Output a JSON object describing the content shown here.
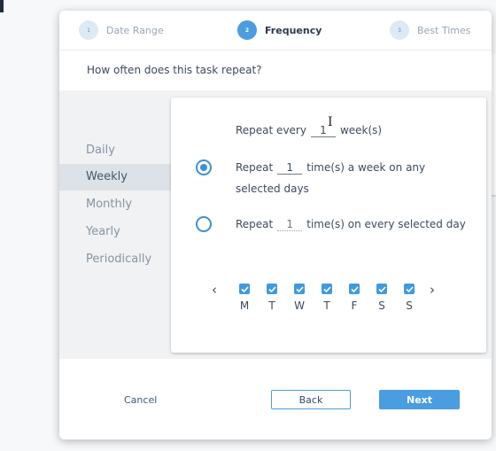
{
  "steps": [
    {
      "num": "1",
      "label": "Date Range",
      "active": false
    },
    {
      "num": "2",
      "label": "Frequency",
      "active": true
    },
    {
      "num": "3",
      "label": "Best Times",
      "active": false
    }
  ],
  "question": "How often does this task repeat?",
  "frequency_options": [
    "Daily",
    "Weekly",
    "Monthly",
    "Yearly",
    "Periodically"
  ],
  "selected_frequency": "Weekly",
  "repeat_every": {
    "prefix": "Repeat every",
    "value": "1",
    "suffix": "week(s)"
  },
  "option_a": {
    "prefix": "Repeat",
    "value": "1",
    "suffix_line1": "time(s) a week on any",
    "suffix_line2": "selected days",
    "selected": true
  },
  "option_b": {
    "prefix": "Repeat",
    "placeholder": "1",
    "suffix": "time(s) on every selected day",
    "selected": false
  },
  "days": [
    {
      "label": "M",
      "checked": true
    },
    {
      "label": "T",
      "checked": true
    },
    {
      "label": "W",
      "checked": true
    },
    {
      "label": "T",
      "checked": true
    },
    {
      "label": "F",
      "checked": true
    },
    {
      "label": "S",
      "checked": true
    },
    {
      "label": "S",
      "checked": true
    }
  ],
  "nav": {
    "prev_icon": "chevron-left-icon",
    "next_icon": "chevron-right-icon"
  },
  "footer": {
    "cancel_label": "Cancel",
    "back_label": "Back",
    "next_label": "Next"
  },
  "colors": {
    "accent": "#4a9de0",
    "selected_bg": "#dde2e8"
  }
}
